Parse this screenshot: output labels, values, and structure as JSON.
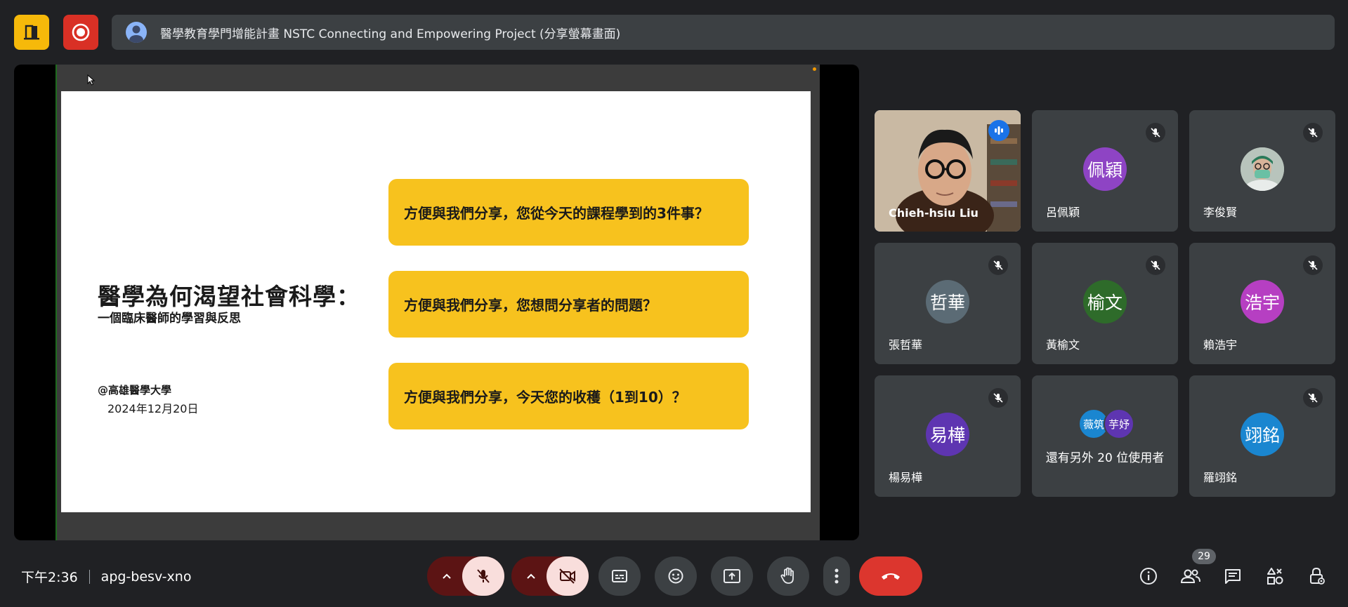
{
  "header": {
    "meeting_title": "醫學教育學門增能計畫 NSTC Connecting and Empowering Project (分享螢幕畫面)"
  },
  "slide": {
    "title": "醫學為何渴望社會科學：",
    "subtitle": "一個臨床醫師的學習與反思",
    "org": "@高雄醫學大學",
    "date": "2024年12月20日",
    "questions": [
      "方便與我們分享，您從今天的課程學到的3件事？",
      "方便與我們分享，您想問分享者的問題？",
      "方便與我們分享，今天您的收穫（1到10）？"
    ],
    "box_color": "#f7c21e"
  },
  "participants": [
    {
      "name": "Chieh-hsiu Liu",
      "state": "speaking",
      "has_video": true
    },
    {
      "name": "呂佩穎",
      "initials": "佩穎",
      "color": "#8e44c4",
      "state": "muted"
    },
    {
      "name": "李俊賢",
      "state": "muted",
      "photo": true
    },
    {
      "name": "張哲華",
      "initials": "哲華",
      "color": "#5b6b75",
      "state": "muted"
    },
    {
      "name": "黃榆文",
      "initials": "榆文",
      "color": "#2e6b2a",
      "state": "muted"
    },
    {
      "name": "賴浩宇",
      "initials": "浩宇",
      "color": "#b63fc2",
      "state": "muted"
    },
    {
      "name": "楊易樺",
      "initials": "易樺",
      "color": "#5e35b1",
      "state": "muted"
    },
    {
      "name": "羅翊銘",
      "initials": "翊銘",
      "color": "#1a86d0",
      "state": "muted"
    }
  ],
  "others": {
    "avatars": [
      {
        "initials": "薇筑",
        "color": "#1a86d0"
      },
      {
        "initials": "芋妤",
        "color": "#5e35b1"
      }
    ],
    "text": "還有另外 20 位使用者"
  },
  "footer": {
    "time": "下午2:36",
    "meeting_code": "apg-besv-xno",
    "participant_count": "29"
  },
  "colors": {
    "accent": "#8ab4f8",
    "end_call": "#dc362e",
    "muted_bg": "#f9dedc"
  },
  "icons": [
    "door-icon",
    "record-icon",
    "person-icon",
    "mic-off-icon",
    "camera-off-icon",
    "captions-icon",
    "emoji-icon",
    "present-icon",
    "raise-hand-icon",
    "more-vert-icon",
    "end-call-icon",
    "info-icon",
    "people-icon",
    "chat-icon",
    "activities-icon",
    "host-controls-icon"
  ]
}
